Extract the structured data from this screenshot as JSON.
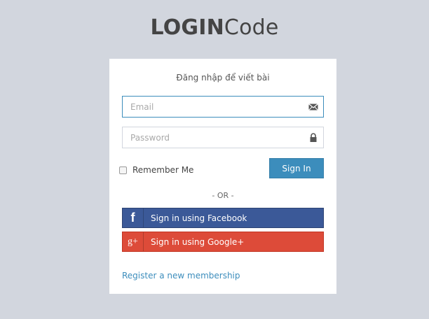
{
  "logo": {
    "bold": "LOGIN",
    "light": "Code"
  },
  "box_message": "Đăng nhập để viết bài",
  "email": {
    "placeholder": "Email",
    "icon": "envelope-icon"
  },
  "password": {
    "placeholder": "Password",
    "icon": "lock-icon"
  },
  "remember_label": "Remember Me",
  "signin_label": "Sign In",
  "or_text": "- OR -",
  "facebook": {
    "icon_text": "f",
    "label": "Sign in using Facebook",
    "color": "#3b5998"
  },
  "google": {
    "icon_text": "g+",
    "label": "Sign in using Google+",
    "color": "#dd4b39"
  },
  "register_link": "Register a new membership",
  "colors": {
    "background": "#d2d6de",
    "primary": "#3c8dbc"
  }
}
